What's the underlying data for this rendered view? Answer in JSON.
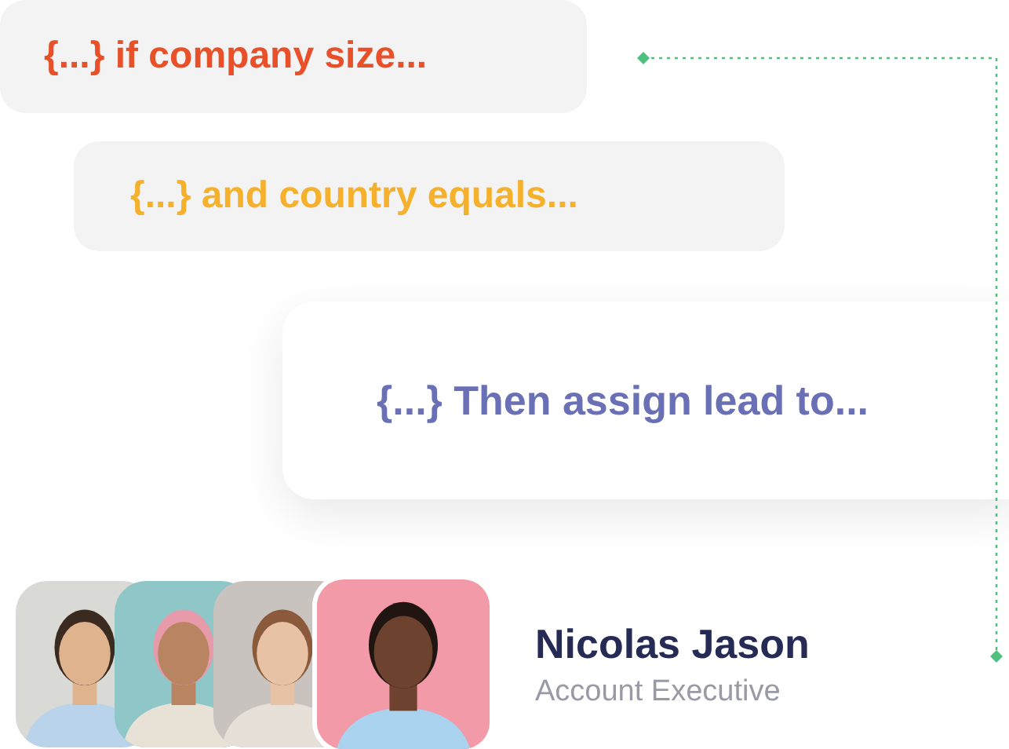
{
  "rules": [
    {
      "text": "{...} if company size...",
      "color": "#e8502a"
    },
    {
      "text": "{...} and country equals...",
      "color": "#f5b02c"
    },
    {
      "text": "{...} Then assign lead to...",
      "color": "#6a70b5"
    }
  ],
  "person": {
    "name": "Nicolas Jason",
    "role": "Account Executive"
  }
}
